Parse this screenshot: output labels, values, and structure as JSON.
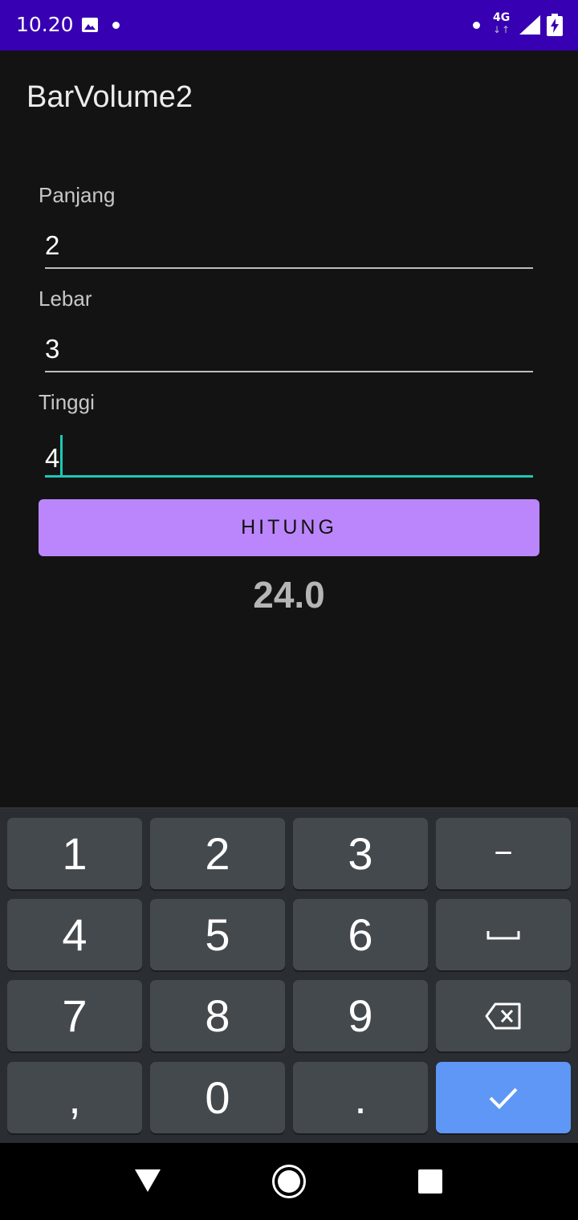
{
  "status_bar": {
    "time": "10.20",
    "network": "4G",
    "network_arrows": "↓↑",
    "icons": [
      "image-icon",
      "notification-dot-icon",
      "signal-icon",
      "battery-charging-icon"
    ]
  },
  "app": {
    "title": "BarVolume2"
  },
  "form": {
    "panjang": {
      "label": "Panjang",
      "value": "2"
    },
    "lebar": {
      "label": "Lebar",
      "value": "3"
    },
    "tinggi": {
      "label": "Tinggi",
      "value": "4"
    },
    "button_label": "HITUNG",
    "result": "24.0"
  },
  "keyboard": {
    "keys": [
      "1",
      "2",
      "3",
      "−",
      "4",
      "5",
      "6",
      "␣",
      "7",
      "8",
      "9",
      "⌫",
      ",",
      "0",
      ".",
      "✓"
    ]
  },
  "nav_bar": {
    "icons": [
      "back-icon",
      "home-icon",
      "recents-icon"
    ]
  },
  "colors": {
    "status_bar": "#3700b3",
    "accent": "#1dc8b4",
    "button": "#bb86fc",
    "confirm_key": "#5e97f6",
    "background": "#131313"
  }
}
